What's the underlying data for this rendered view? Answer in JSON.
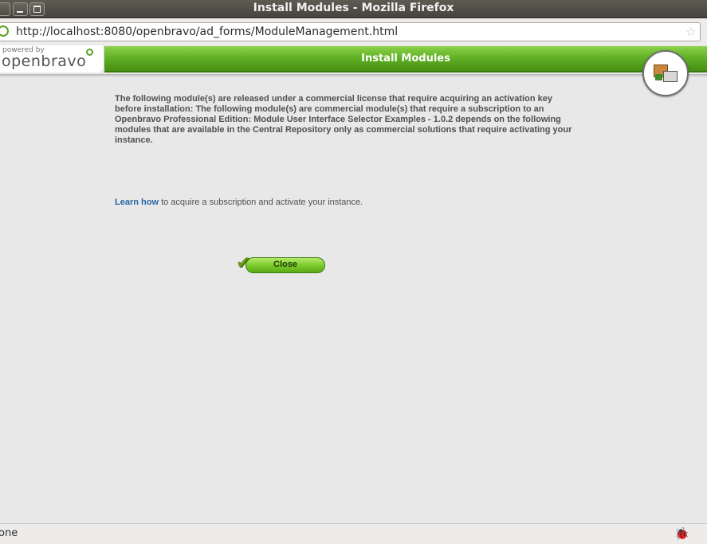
{
  "window": {
    "title": "Install Modules - Mozilla Firefox"
  },
  "browser": {
    "url": "http://localhost:8080/openbravo/ad_forms/ModuleManagement.html",
    "status": "one"
  },
  "app": {
    "logo_powered": "powered by",
    "logo_name": "openbravo",
    "header_title": "Install Modules"
  },
  "content": {
    "message": "The following module(s) are released under a commercial license that require acquiring an activation key before installation: The following module(s) are commercial module(s) that require a subscription to an Openbravo Professional Edition: Module User Interface Selector Examples - 1.0.2 depends on the following modules that are available in the Central Repository only as commercial solutions that require activating your instance.",
    "learn_link": "Learn how",
    "learn_rest": " to acquire a subscription and activate your instance.",
    "close_label": "Close"
  },
  "icons": {
    "site": "openbravo-site-icon",
    "star": "star-icon",
    "module": "module-install-icon",
    "check": "checkmark-icon",
    "bug": "bug-icon"
  },
  "colors": {
    "header_green": "#5fae24",
    "link_blue": "#2467a6",
    "page_bg": "#e8e8e8"
  }
}
